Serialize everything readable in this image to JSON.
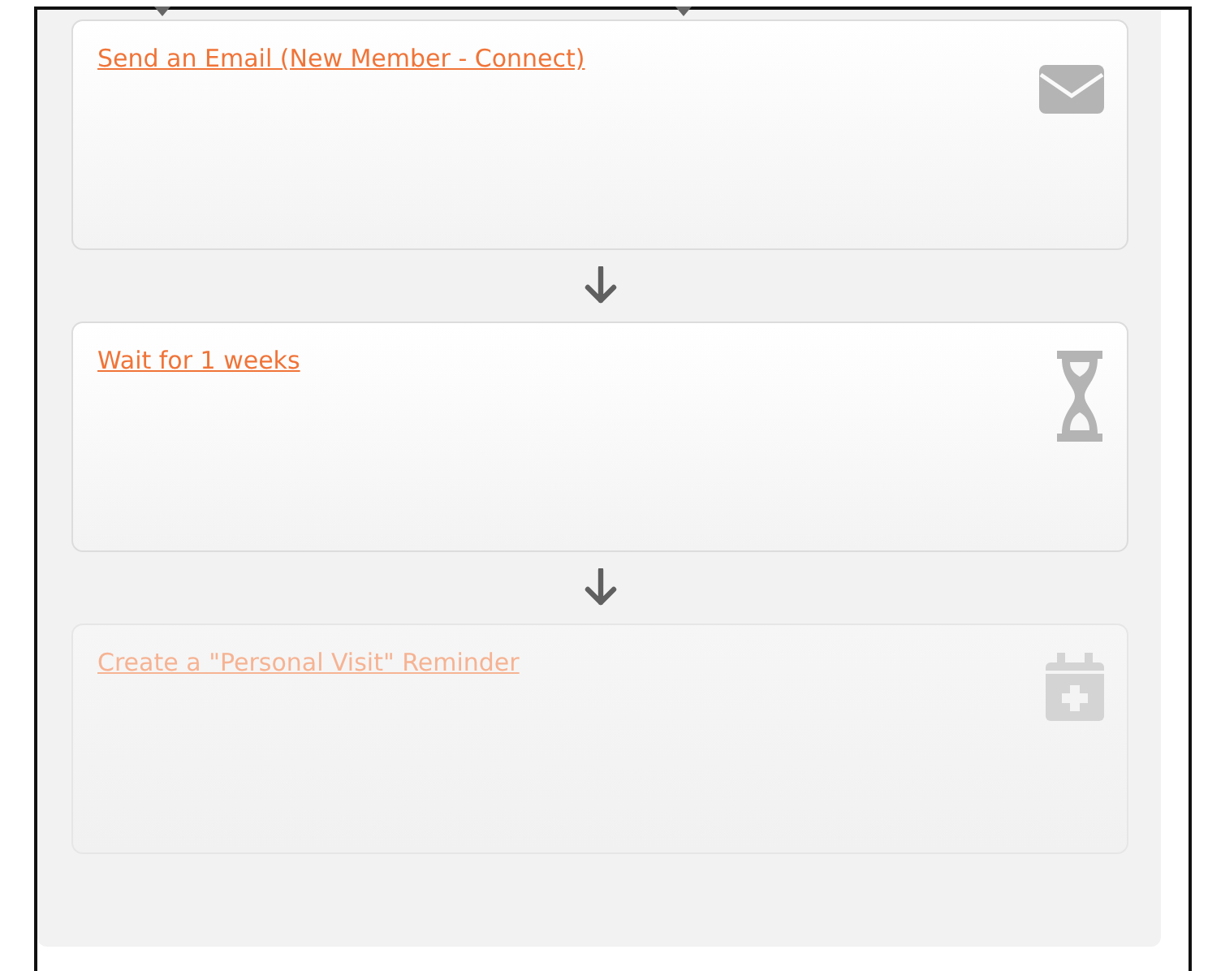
{
  "steps": [
    {
      "kind": "email",
      "label": "Send an Email (New Member - Connect)",
      "disabled": false
    },
    {
      "kind": "wait",
      "label": "Wait for 1 weeks",
      "disabled": false
    },
    {
      "kind": "reminder",
      "label": "Create a \"Personal Visit\" Reminder",
      "disabled": true
    }
  ]
}
